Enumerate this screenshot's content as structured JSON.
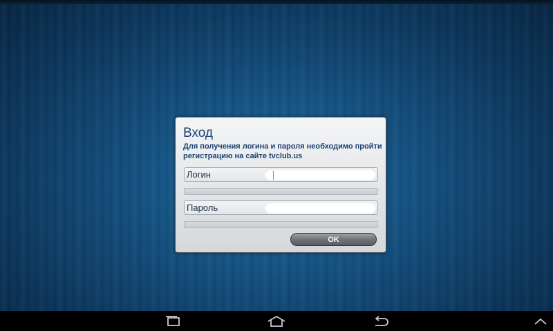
{
  "dialog": {
    "title": "Вход",
    "description": "Для получения логина и пароля необходимо пройти регистрацию на сайте tvclub.us",
    "login": {
      "label": "Логин",
      "value": ""
    },
    "password": {
      "label": "Пароль",
      "value": ""
    },
    "ok_label": "OK"
  },
  "nav_bar": {
    "icons": [
      "recent-apps-icon",
      "home-icon",
      "back-icon",
      "chevron-up-icon"
    ]
  },
  "colors": {
    "background": "#134d7c",
    "title_text": "#1c4274",
    "nav_bar": "#000000",
    "button": "#6f747a"
  }
}
